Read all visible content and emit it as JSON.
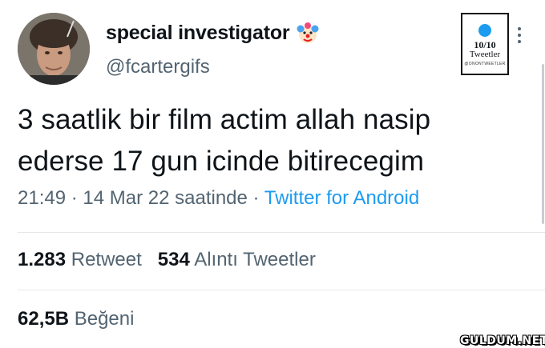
{
  "user": {
    "display_name": "special investigator",
    "handle": "@fcartergifs",
    "name_emoji": "clown-face-icon"
  },
  "badge": {
    "score": "10/10",
    "label": "Tweetler",
    "sub": "@ONONTWEETLER"
  },
  "tweet": {
    "lines": [
      "3 saatlik bir film actim allah nasip",
      "ederse 17 gun icinde bitirecegim"
    ],
    "time": "21:49",
    "date": "14 Mar 22 saatinde",
    "separator": "·",
    "source": "Twitter for Android"
  },
  "stats": {
    "retweets_count": "1.283",
    "retweets_label": "Retweet",
    "quotes_count": "534",
    "quotes_label": "Alıntı Tweetler",
    "likes_count": "62,5B",
    "likes_label": "Beğeni"
  },
  "watermark": "GULDUM.NET",
  "colors": {
    "text": "#0f1419",
    "secondary": "#536471",
    "link": "#1d9bf0",
    "divider": "#e3e7ea"
  }
}
